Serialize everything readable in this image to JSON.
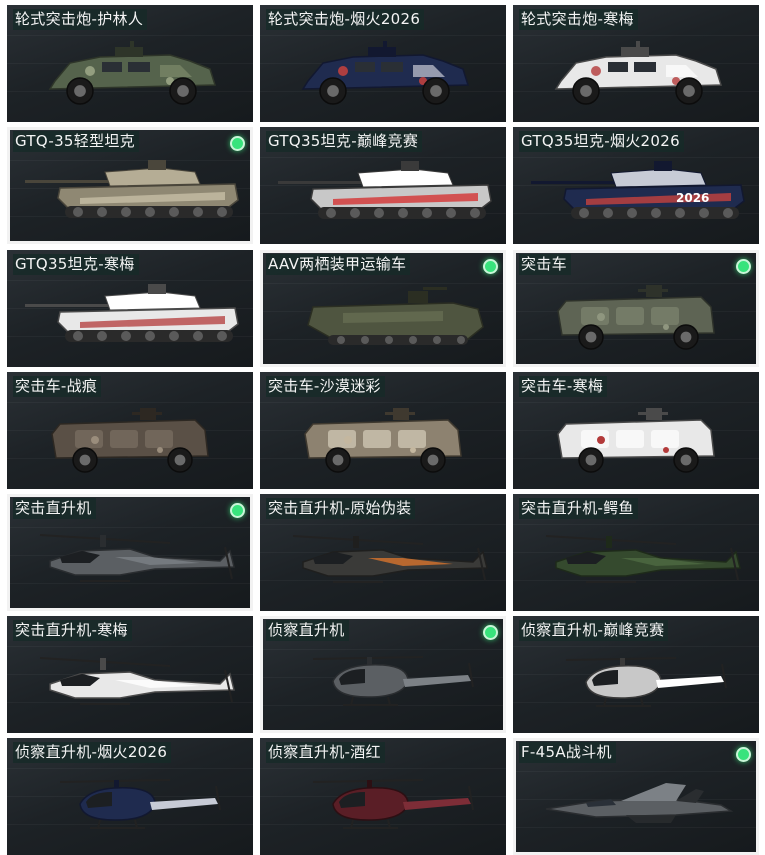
{
  "colors": {
    "card_background": "#1d2226",
    "label_background": "#162a28",
    "owned_indicator": "#38e37c",
    "selected_border": "#f2f2f2"
  },
  "skins": [
    {
      "label": "轮式突击炮-护林人",
      "type": "wheeled",
      "scheme": "forest",
      "selected": false,
      "owned": false
    },
    {
      "label": "轮式突击炮-烟火2026",
      "type": "wheeled",
      "scheme": "firework",
      "selected": false,
      "owned": false
    },
    {
      "label": "轮式突击炮-寒梅",
      "type": "wheeled",
      "scheme": "plum",
      "selected": false,
      "owned": false
    },
    {
      "label": "GTQ-35轻型坦克",
      "type": "tank",
      "scheme": "desert",
      "selected": true,
      "owned": true
    },
    {
      "label": "GTQ35坦克-巅峰竞赛",
      "type": "tank",
      "scheme": "racing",
      "selected": false,
      "owned": false
    },
    {
      "label": "GTQ35坦克-烟火2026",
      "type": "tank",
      "scheme": "firework",
      "selected": false,
      "owned": false,
      "decal": "2026"
    },
    {
      "label": "GTQ35坦克-寒梅",
      "type": "tank",
      "scheme": "plum",
      "selected": false,
      "owned": false
    },
    {
      "label": "AAV两栖装甲运输车",
      "type": "aav",
      "scheme": "olive",
      "selected": true,
      "owned": true
    },
    {
      "label": "突击车",
      "type": "mrap",
      "scheme": "green",
      "selected": true,
      "owned": true
    },
    {
      "label": "突击车-战痕",
      "type": "mrap",
      "scheme": "scarred",
      "selected": false,
      "owned": false
    },
    {
      "label": "突击车-沙漠迷彩",
      "type": "mrap",
      "scheme": "sand",
      "selected": false,
      "owned": false
    },
    {
      "label": "突击车-寒梅",
      "type": "mrap",
      "scheme": "plum",
      "selected": false,
      "owned": false
    },
    {
      "label": "突击直升机",
      "type": "apache",
      "scheme": "grey",
      "selected": true,
      "owned": true
    },
    {
      "label": "突击直升机-原始伪装",
      "type": "apache",
      "scheme": "orange",
      "selected": false,
      "owned": false
    },
    {
      "label": "突击直升机-鳄鱼",
      "type": "apache",
      "scheme": "croc",
      "selected": false,
      "owned": false
    },
    {
      "label": "突击直升机-寒梅",
      "type": "apache",
      "scheme": "plum",
      "selected": false,
      "owned": false
    },
    {
      "label": "侦察直升机",
      "type": "scout",
      "scheme": "grey",
      "selected": true,
      "owned": true
    },
    {
      "label": "侦察直升机-巅峰竞赛",
      "type": "scout",
      "scheme": "racing",
      "selected": false,
      "owned": false
    },
    {
      "label": "侦察直升机-烟火2026",
      "type": "scout",
      "scheme": "firework",
      "selected": false,
      "owned": false
    },
    {
      "label": "侦察直升机-酒红",
      "type": "scout",
      "scheme": "wine",
      "selected": false,
      "owned": false
    },
    {
      "label": "F-45A战斗机",
      "type": "jet",
      "scheme": "grey",
      "selected": true,
      "owned": true
    }
  ]
}
